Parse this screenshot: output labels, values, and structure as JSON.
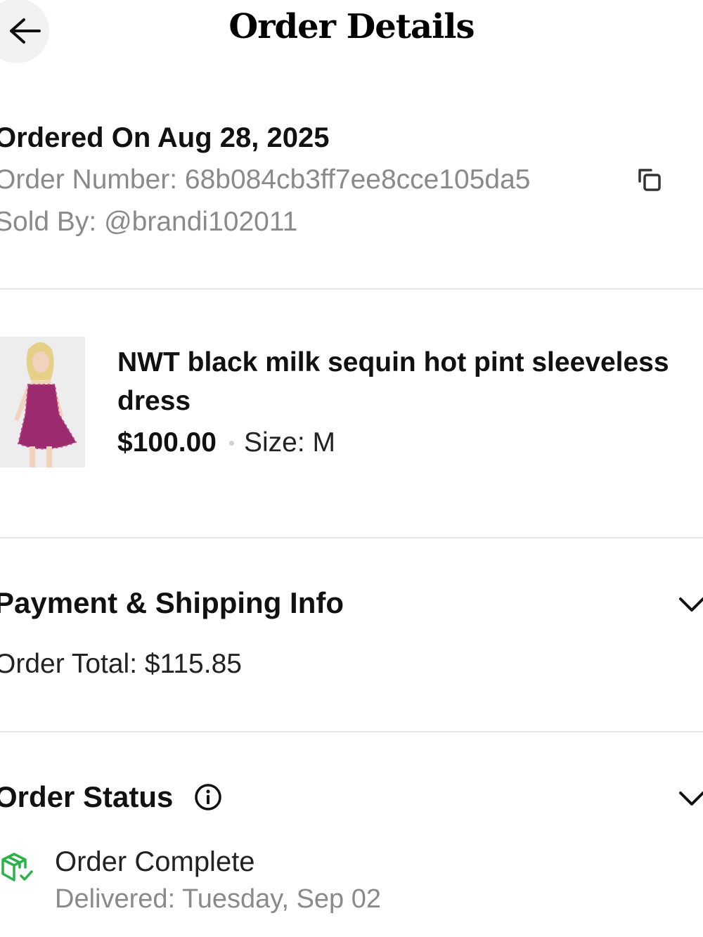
{
  "header": {
    "title": "Order Details",
    "back_icon": "arrow-left-icon"
  },
  "order": {
    "ordered_on": "Ordered On Aug 28, 2025",
    "order_number": "Order Number: 68b084cb3ff7ee8cce105da5",
    "sold_by": "Sold By:  @brandi102011",
    "copy_icon": "copy-icon"
  },
  "product": {
    "title": "NWT black milk sequin hot pint sleeveless dress",
    "price": "$100.00",
    "size": "Size: M",
    "image_icon": "product-photo"
  },
  "payment": {
    "heading": "Payment & Shipping Info",
    "order_total": "Order Total: $115.85"
  },
  "status": {
    "heading": "Order Status",
    "title": "Order Complete",
    "delivered": "Delivered:  Tuesday, Sep 02",
    "status_icon": "package-check-icon",
    "status_color": "#2bb34a"
  },
  "colors": {
    "divider": "#e6e6e6",
    "muted_text": "#8a8a8a",
    "back_button_bg": "#f2f2f2"
  }
}
